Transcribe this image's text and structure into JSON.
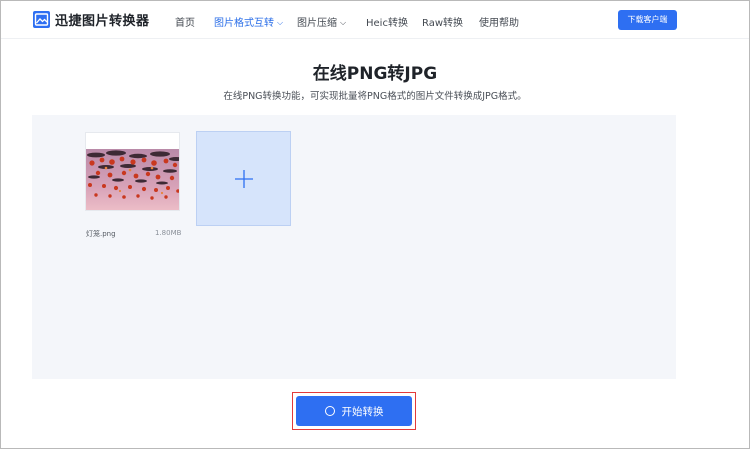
{
  "header": {
    "brand": "迅捷图片转换器",
    "nav": [
      {
        "label": "首页",
        "active": false,
        "dropdown": false
      },
      {
        "label": "图片格式互转",
        "active": true,
        "dropdown": true
      },
      {
        "label": "图片压缩",
        "active": false,
        "dropdown": true
      },
      {
        "label": "Heic转换",
        "active": false,
        "dropdown": false
      },
      {
        "label": "Raw转换",
        "active": false,
        "dropdown": false
      },
      {
        "label": "使用帮助",
        "active": false,
        "dropdown": false
      }
    ],
    "download_label": "下载客户端"
  },
  "page": {
    "title": "在线PNG转JPG",
    "subtitle": "在线PNG转换功能，可实现批量将PNG格式的图片文件转换成JPG格式。"
  },
  "files": [
    {
      "name": "灯笼.png",
      "size": "1.80MB"
    }
  ],
  "start_label": "开始转换",
  "colors": {
    "accent": "#2e6ff2",
    "highlight": "#e33a3a",
    "upload_bg": "#d6e4fb"
  },
  "icons": {
    "logo": "image-icon",
    "add": "plus-icon",
    "dropdown": "chevron-down-icon",
    "start": "spinner-icon"
  }
}
